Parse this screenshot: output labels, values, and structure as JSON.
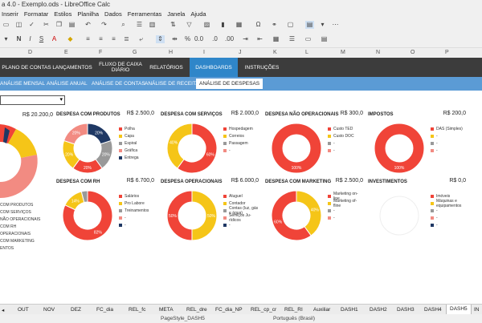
{
  "window": {
    "title": "a 4.0 - Exemplo.ods - LibreOffice Calc"
  },
  "menu": [
    "Inserir",
    "Formatar",
    "Estilos",
    "Planilha",
    "Dados",
    "Ferramentas",
    "Janela",
    "Ajuda"
  ],
  "columns": [
    "D",
    "E",
    "F",
    "G",
    "H",
    "I",
    "J",
    "K",
    "L",
    "M",
    "N",
    "O",
    "P"
  ],
  "topnav": [
    "PLANO DE CONTAS",
    "LANÇAMENTOS",
    "FLUXO DE CAIXA DIÁRIO",
    "RELATÓRIOS",
    "DASHBOARDS",
    "INSTRUÇÕES"
  ],
  "subnav": [
    "ANÁLISE MENSAL",
    "ANÁLISE ANUAL",
    "ANÁLISE DE CONTAS",
    "ANÁLISE DE RECEITAS",
    "ANÁLISE DE DESPESAS"
  ],
  "left_panel": {
    "value": "R$ 20.200,0",
    "legend": [
      "COM PRODUTOS",
      "COM SERVIÇOS",
      "NÃO OPERACIONAIS",
      "COM RH",
      "OPERACIONAIS",
      "COM MARKETING",
      "ENTOS"
    ]
  },
  "panels": [
    {
      "title": "DESPESA COM PRODUTOS",
      "value": "R$ 2.500,0",
      "labels": [
        "20%",
        "20%",
        "20%",
        "20%",
        "20%"
      ],
      "legend": [
        "Polha",
        "Capa",
        "Espiral",
        "Gráfica",
        "Entrega"
      ]
    },
    {
      "title": "DESPESA COM SERVIÇOS",
      "value": "R$ 2.000,0",
      "labels": [
        "60%",
        "40%"
      ],
      "legend": [
        "Hospedagem",
        "Correios",
        "Passagem",
        "-"
      ]
    },
    {
      "title": "DESPESA NÃO OPERACIONAIS",
      "value": "R$ 300,0",
      "labels": [
        "100%"
      ],
      "legend": [
        "Custo TED",
        "Custo DOC",
        "-",
        "-"
      ]
    },
    {
      "title": "IMPOSTOS",
      "value": "R$ 200,0",
      "labels": [
        "100%"
      ],
      "legend": [
        "DAS (Simples)",
        "-",
        "-",
        "-"
      ]
    },
    {
      "title": "DESPESA COM RH",
      "value": "R$ 6.700,0",
      "labels": [
        "82%",
        "14%"
      ],
      "legend": [
        "Salários",
        "Pro Labore",
        "Treinamentos",
        "-",
        "-"
      ]
    },
    {
      "title": "DESPESA OPERACIONAIS",
      "value": "R$ 6.000,0",
      "labels": [
        "50%",
        "50%"
      ],
      "legend": [
        "Aluguel",
        "Contador",
        "Contas (luz, gás e água)",
        "Serviços Ju- rídicos",
        "-"
      ]
    },
    {
      "title": "DESPESA COM MARKETING",
      "value": "R$ 2.500,0",
      "labels": [
        "40%",
        "60%"
      ],
      "legend": [
        "Marketing on- line",
        "Marketing of- fline",
        "-",
        "-"
      ]
    },
    {
      "title": "INVESTIMENTOS",
      "value": "R$ 0,0",
      "labels": [],
      "legend": [
        "Imóveis",
        "Máquinas e equipamentos",
        "-",
        "-",
        "-"
      ]
    }
  ],
  "sheet_tabs": [
    "OUT",
    "NOV",
    "DEZ",
    "FC_dia",
    "REL_fc",
    "META",
    "REL_dre",
    "FC_dia_NP",
    "REL_cp_cr",
    "REL_RI",
    "Auxiliar",
    "DASH1",
    "DASH2",
    "DASH3",
    "DASH4",
    "DASH5",
    "IN"
  ],
  "status": {
    "page_style": "PageStyle_DASH5",
    "language": "Português (Brasil)"
  },
  "colors": {
    "red": "#f04438",
    "yellow": "#f5c518",
    "gray": "#999999",
    "salmon": "#f28b82",
    "navy": "#1f3864",
    "nav_dark": "#3c3c3c",
    "nav_blue": "#2f86c9",
    "sub_blue": "#5b9bd5"
  }
}
